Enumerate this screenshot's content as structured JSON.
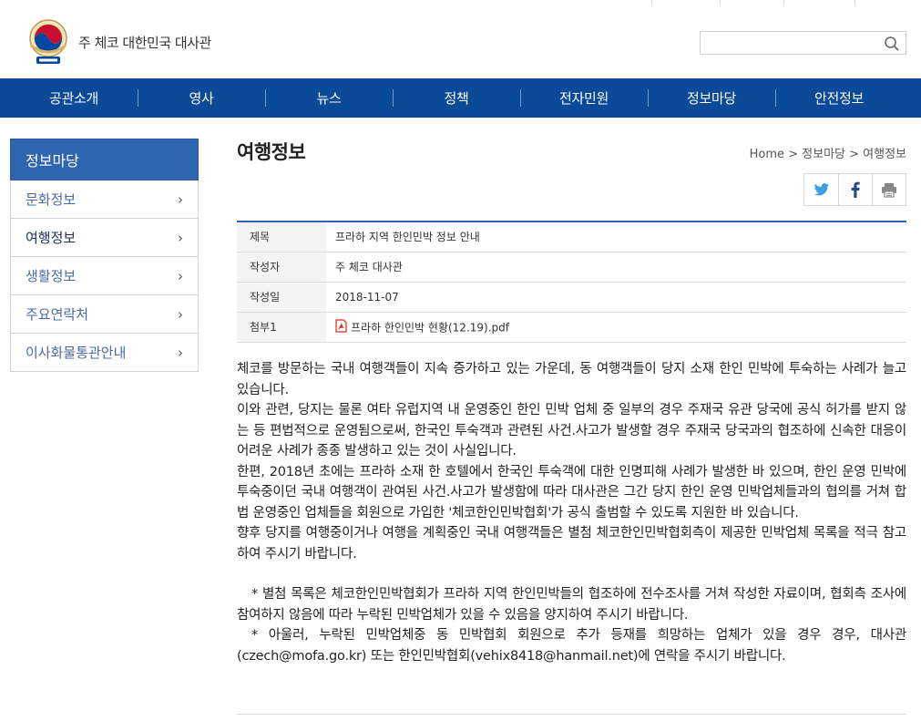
{
  "header": {
    "site_title": "주 체코 대한민국 대사관",
    "search_placeholder": ""
  },
  "nav": [
    "공관소개",
    "영사",
    "뉴스",
    "정책",
    "전자민원",
    "정보마당",
    "안전정보"
  ],
  "sidebar": {
    "title": "정보마당",
    "items": [
      {
        "label": "문화정보"
      },
      {
        "label": "여행정보"
      },
      {
        "label": "생활정보"
      },
      {
        "label": "주요연락처"
      },
      {
        "label": "이사화물통관안내"
      }
    ]
  },
  "content": {
    "page_title": "여행정보",
    "breadcrumb": "Home > 정보마당 > 여행정보",
    "info": {
      "subject_label": "제목",
      "subject_value": "프라하 지역 한인민박 정보 안내",
      "author_label": "작성자",
      "author_value": "주 체코 대사관",
      "date_label": "작성일",
      "date_value": "2018-11-07",
      "attach_label": "첨부1",
      "attach_value": "프라하 한인민박 현황(12.19).pdf"
    },
    "paragraphs": [
      "체코를 방문하는 국내 여행객들이 지속 증가하고 있는 가운데, 동 여행객들이 당지 소재 한인 민박에 투숙하는 사례가 늘고 있습니다.",
      "이와 관련, 당지는 물론 여타 유럽지역 내 운영중인 한인 민박 업체 중 일부의 경우 주재국 유관 당국에 공식 허가를 받지 않는 등 편법적으로 운영됨으로써, 한국인 투숙객과 관련된 사건.사고가 발생할 경우 주재국 당국과의 협조하에 신속한 대응이 어려운 사례가 종종 발생하고 있는 것이 사실입니다.",
      "한편, 2018년 초에는 프라하 소재 한 호텔에서 한국인 투숙객에 대한 인명피해 사례가 발생한 바 있으며, 한인 운영 민박에 투숙중이던 국내 여행객이 관여된 사건.사고가 발생함에 따라 대사관은 그간 당지 한인 운영 민박업체들과의 협의를 거쳐 합법 운영중인 업체들을 회원으로 가입한 '체코한인민박협회'가 공식 출범할 수 있도록 지원한 바 있습니다.",
      "향후 당지를 여행중이거나 여행을 계획중인 국내 여행객들은 별첨 체코한인민박협회측이 제공한 민박업체 목록을 적극 참고하여 주시기 바랍니다."
    ],
    "notes": [
      "* 별첨 목록은 체코한인민박협회가 프라하 지역 한인민박들의 협조하에 전수조사를 거쳐 작성한 자료이며, 협회측 조사에 참여하지 않음에 따라 누락된 민박업체가 있을 수 있음을 양지하여 주시기 바랍니다.",
      "* 아울러, 누락된 민박업체중 동 민박협회 회원으로 추가 등재를 희망하는 업체가 있을 경우 경우, 대사관(czech@mofa.go.kr) 또는 한인민박협회(vehix8418@hanmail.net)에 연락을 주시기 바랍니다."
    ]
  },
  "colors": {
    "nav_bg": "#0b4a98",
    "sidebar_title_bg": "#2f64b0",
    "twitter": "#3b9fe0",
    "facebook": "#2a4a8c",
    "pdf": "#d6281f"
  },
  "icons": [
    "emblem-logo",
    "search-icon",
    "chevron-right-icon",
    "twitter-icon",
    "facebook-icon",
    "print-icon",
    "pdf-icon"
  ]
}
